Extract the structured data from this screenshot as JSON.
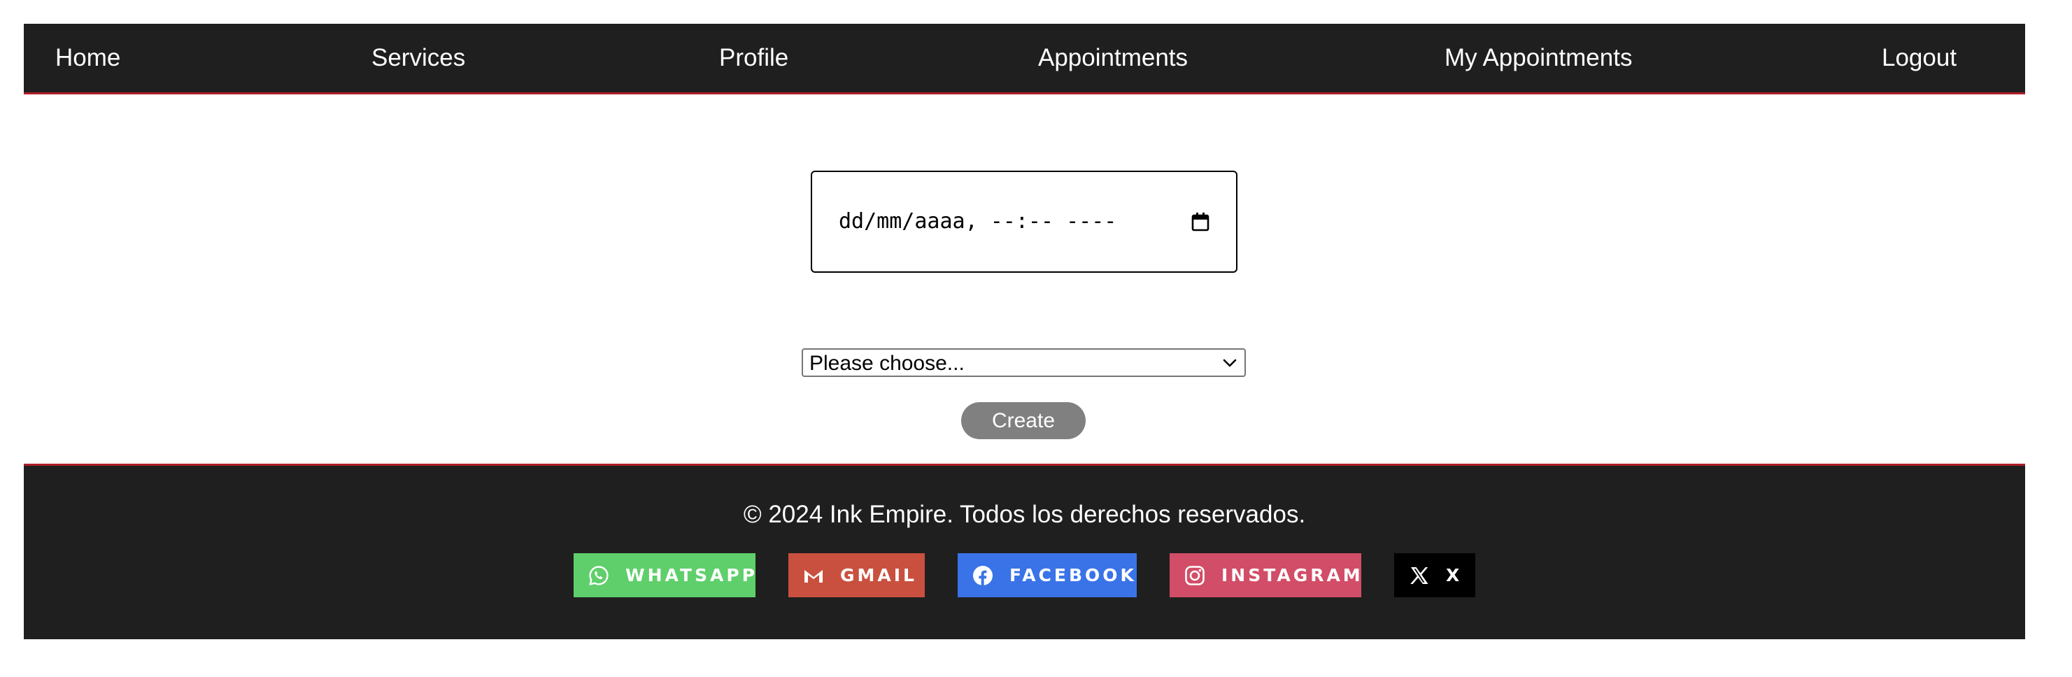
{
  "nav": {
    "items": [
      {
        "label": "Home"
      },
      {
        "label": "Services"
      },
      {
        "label": "Profile"
      },
      {
        "label": "Appointments"
      },
      {
        "label": "My Appointments"
      },
      {
        "label": "Logout"
      }
    ]
  },
  "form": {
    "datetime_placeholder": "dd/mm/aaaa, --:-- ----",
    "select_value": "Please choose...",
    "create_label": "Create"
  },
  "footer": {
    "copyright": "© 2024 Ink Empire. Todos los derechos reservados.",
    "social": [
      {
        "label": "WHATSAPP",
        "icon": "whatsapp-icon",
        "color": "#5fcf6b"
      },
      {
        "label": "GMAIL",
        "icon": "gmail-icon",
        "color": "#c9503f"
      },
      {
        "label": "FACEBOOK",
        "icon": "facebook-icon",
        "color": "#3a73e8"
      },
      {
        "label": "INSTAGRAM",
        "icon": "instagram-icon",
        "color": "#d24d67"
      },
      {
        "label": "X",
        "icon": "x-icon",
        "color": "#000000"
      }
    ]
  },
  "colors": {
    "bar_background": "#1f1f1f",
    "accent_line": "#b01e2a",
    "button_gray": "#808080"
  }
}
